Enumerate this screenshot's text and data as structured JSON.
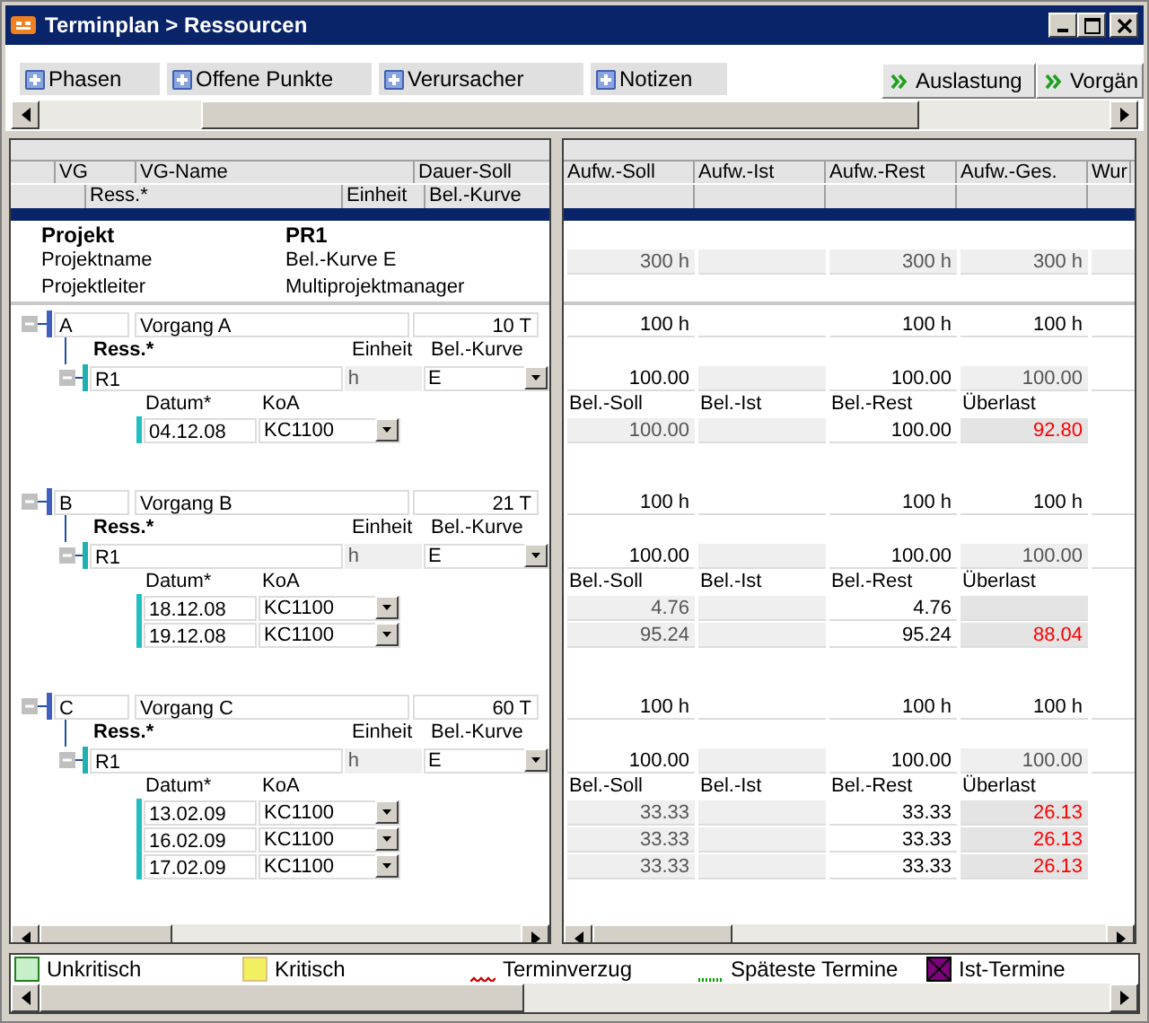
{
  "window": {
    "title": "Terminplan > Ressourcen"
  },
  "tabs": [
    {
      "label": "Phasen"
    },
    {
      "label": "Offene Punkte"
    },
    {
      "label": "Verursacher"
    },
    {
      "label": "Notizen"
    }
  ],
  "buttons": [
    {
      "label": "Auslastung"
    },
    {
      "label": "Vorgän"
    }
  ],
  "left_header": {
    "row_1": [
      "VG",
      "VG-Name",
      "Dauer-Soll"
    ],
    "row_2": [
      "Ress.*",
      "Einheit",
      "Bel.-Kurve"
    ]
  },
  "right_header": [
    "Aufw.-Soll",
    "Aufw.-Ist",
    "Aufw.-Rest",
    "Aufw.-Ges.",
    "Wur"
  ],
  "project": [
    {
      "kind": "heading",
      "label": "Projekt",
      "value": "PR1"
    },
    {
      "kind": "field",
      "label": "Projektname",
      "value": "Bel.-Kurve E",
      "totals": {
        "soll": "300 h",
        "rest": "300 h",
        "ges": "300 h"
      }
    },
    {
      "kind": "field",
      "label": "Projektleiter",
      "value": "Multiprojektmanager"
    }
  ],
  "tasks": [
    {
      "vg": "A",
      "name": "Vorgang A",
      "duration": "10 T",
      "expanded": true,
      "effort": {
        "soll": "100 h",
        "rest": "100 h",
        "ges": "100 h"
      },
      "resource_labels": [
        "Ress.*",
        "Einheit",
        "Bel.-Kurve"
      ],
      "resources": [
        {
          "name": "R1",
          "unit": "h",
          "curve": "E",
          "expanded": true,
          "soll": "100.00",
          "rest": "100.00",
          "ges": "100.00",
          "date_labels": [
            "Datum*",
            "KoA"
          ],
          "load_labels": [
            "Bel.-Soll",
            "Bel.-Ist",
            "Bel.-Rest",
            "Überlast"
          ],
          "dates": [
            {
              "date": "04.12.08",
              "koa": "KC1100",
              "soll": "100.00",
              "rest": "100.00",
              "overload": "92.80"
            }
          ]
        }
      ]
    },
    {
      "vg": "B",
      "name": "Vorgang B",
      "duration": "21 T",
      "expanded": true,
      "effort": {
        "soll": "100 h",
        "rest": "100 h",
        "ges": "100 h"
      },
      "resource_labels": [
        "Ress.*",
        "Einheit",
        "Bel.-Kurve"
      ],
      "resources": [
        {
          "name": "R1",
          "unit": "h",
          "curve": "E",
          "expanded": true,
          "soll": "100.00",
          "rest": "100.00",
          "ges": "100.00",
          "date_labels": [
            "Datum*",
            "KoA"
          ],
          "load_labels": [
            "Bel.-Soll",
            "Bel.-Ist",
            "Bel.-Rest",
            "Überlast"
          ],
          "dates": [
            {
              "date": "18.12.08",
              "koa": "KC1100",
              "soll": "4.76",
              "rest": "4.76"
            },
            {
              "date": "19.12.08",
              "koa": "KC1100",
              "soll": "95.24",
              "rest": "95.24",
              "overload": "88.04"
            }
          ]
        }
      ]
    },
    {
      "vg": "C",
      "name": "Vorgang C",
      "duration": "60 T",
      "expanded": true,
      "effort": {
        "soll": "100 h",
        "rest": "100 h",
        "ges": "100 h"
      },
      "resource_labels": [
        "Ress.*",
        "Einheit",
        "Bel.-Kurve"
      ],
      "resources": [
        {
          "name": "R1",
          "unit": "h",
          "curve": "E",
          "expanded": true,
          "soll": "100.00",
          "rest": "100.00",
          "ges": "100.00",
          "date_labels": [
            "Datum*",
            "KoA"
          ],
          "load_labels": [
            "Bel.-Soll",
            "Bel.-Ist",
            "Bel.-Rest",
            "Überlast"
          ],
          "dates": [
            {
              "date": "13.02.09",
              "koa": "KC1100",
              "soll": "33.33",
              "rest": "33.33",
              "overload": "26.13"
            },
            {
              "date": "16.02.09",
              "koa": "KC1100",
              "soll": "33.33",
              "rest": "33.33",
              "overload": "26.13"
            },
            {
              "date": "17.02.09",
              "koa": "KC1100",
              "soll": "33.33",
              "rest": "33.33",
              "overload": "26.13"
            }
          ]
        }
      ]
    }
  ],
  "legend": [
    {
      "kind": "swatch",
      "label": "Unkritisch",
      "color": "#c8f0c8"
    },
    {
      "kind": "swatch",
      "label": "Kritisch",
      "color": "#f0f060"
    },
    {
      "kind": "wave",
      "label": "Terminverzug",
      "color": "#d00000"
    },
    {
      "kind": "dots",
      "label": "Späteste Termine",
      "color": "#00a000"
    },
    {
      "kind": "crossed",
      "label": "Ist-Termine",
      "color": "#800080"
    }
  ]
}
